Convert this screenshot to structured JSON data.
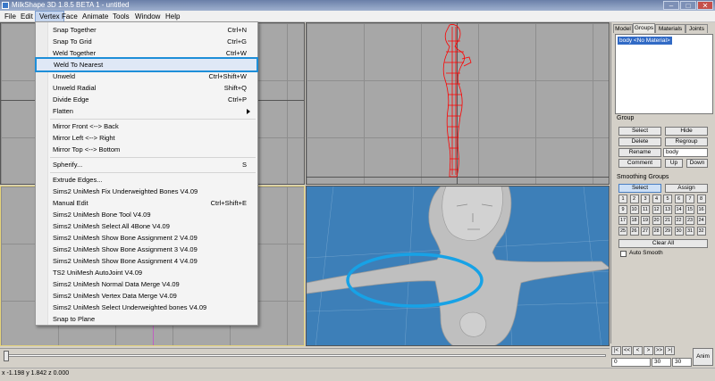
{
  "window": {
    "title": "MilkShape 3D 1.8.5 BETA 1 - untitled",
    "minimize_glyph": "–",
    "maximize_glyph": "□",
    "close_glyph": "✕"
  },
  "menubar": {
    "items": [
      "File",
      "Edit",
      "Vertex",
      "Face",
      "Animate",
      "Tools",
      "Window",
      "Help"
    ],
    "open_menu": "Vertex"
  },
  "vertex_menu": {
    "items": [
      {
        "label": "Snap Together",
        "shortcut": "Ctrl+N"
      },
      {
        "label": "Snap To Grid",
        "shortcut": "Ctrl+G"
      },
      {
        "label": "Weld Together",
        "shortcut": "Ctrl+W"
      },
      {
        "label": "Weld To Nearest",
        "shortcut": "",
        "highlighted": true
      },
      {
        "label": "Unweld",
        "shortcut": "Ctrl+Shift+W"
      },
      {
        "label": "Unweld Radial",
        "shortcut": "Shift+Q"
      },
      {
        "label": "Divide Edge",
        "shortcut": "Ctrl+P"
      },
      {
        "label": "Flatten",
        "shortcut": "",
        "submenu": true
      },
      {
        "label": "Mirror Front <--> Back",
        "shortcut": ""
      },
      {
        "label": "Mirror Left <--> Right",
        "shortcut": ""
      },
      {
        "label": "Mirror Top <--> Bottom",
        "shortcut": ""
      },
      {
        "label": "Spherify...",
        "shortcut": "S"
      },
      {
        "label": "Extrude Edges...",
        "shortcut": ""
      },
      {
        "label": "Sims2 UniMesh Fix Underweighted Bones V4.09",
        "shortcut": ""
      },
      {
        "label": "Manual Edit",
        "shortcut": "Ctrl+Shift+E"
      },
      {
        "label": "Sims2 UniMesh Bone Tool V4.09",
        "shortcut": ""
      },
      {
        "label": "Sims2 UniMesh Select All 4Bone V4.09",
        "shortcut": ""
      },
      {
        "label": "Sims2 UniMesh Show Bone Assignment 2 V4.09",
        "shortcut": ""
      },
      {
        "label": "Sims2 UniMesh Show Bone Assignment 3 V4.09",
        "shortcut": ""
      },
      {
        "label": "Sims2 UniMesh Show Bone Assignment 4 V4.09",
        "shortcut": ""
      },
      {
        "label": "TS2 UniMesh AutoJoint V4.09",
        "shortcut": ""
      },
      {
        "label": "Sims2 UniMesh Normal Data Merge V4.09",
        "shortcut": ""
      },
      {
        "label": "Sims2 UniMesh Vertex Data Merge V4.09",
        "shortcut": ""
      },
      {
        "label": "Sims2 UniMesh Select Underweighted bones V4.09",
        "shortcut": ""
      },
      {
        "label": "Snap to Plane",
        "shortcut": ""
      }
    ]
  },
  "panel": {
    "tabs": [
      "Model",
      "Groups",
      "Materials",
      "Joints"
    ],
    "active_tab": "Groups",
    "group_list": [
      "body <No Material>"
    ],
    "group_section_title": "Group",
    "buttons": {
      "select": "Select",
      "hide": "Hide",
      "delete": "Delete",
      "regroup": "Regroup",
      "rename": "Rename",
      "comment": "Comment",
      "up": "Up",
      "down": "Down"
    },
    "rename_value": "body",
    "smoothing_title": "Smoothing Groups",
    "smoothing_select": "Select",
    "smoothing_assign": "Assign",
    "smoothing_numbers": [
      "1",
      "2",
      "3",
      "4",
      "5",
      "6",
      "7",
      "8",
      "9",
      "10",
      "11",
      "12",
      "13",
      "14",
      "15",
      "16",
      "17",
      "18",
      "19",
      "20",
      "21",
      "22",
      "23",
      "24",
      "25",
      "26",
      "27",
      "28",
      "29",
      "30",
      "31",
      "32"
    ],
    "clear_all": "Clear All",
    "auto_smooth_label": "Auto Smooth",
    "auto_smooth_checked": false
  },
  "timeline": {
    "frame_start": "0",
    "frame_current": "30",
    "frame_end": "30",
    "anim_button": "Anim",
    "nav_glyphs": [
      "|<",
      "<<",
      "<",
      ">",
      ">>",
      ">|"
    ]
  },
  "status": {
    "coords": "x -1.198 y 1.842 z 0.000"
  },
  "colors": {
    "viewport_gray": "#a7a7a7",
    "viewport_3d": "#3d7fb8",
    "wireframe": "#ff0000",
    "annotation_ellipse": "#17a2e6",
    "menu_highlight_outline": "#1d8ed8",
    "selection": "#316ac5"
  }
}
